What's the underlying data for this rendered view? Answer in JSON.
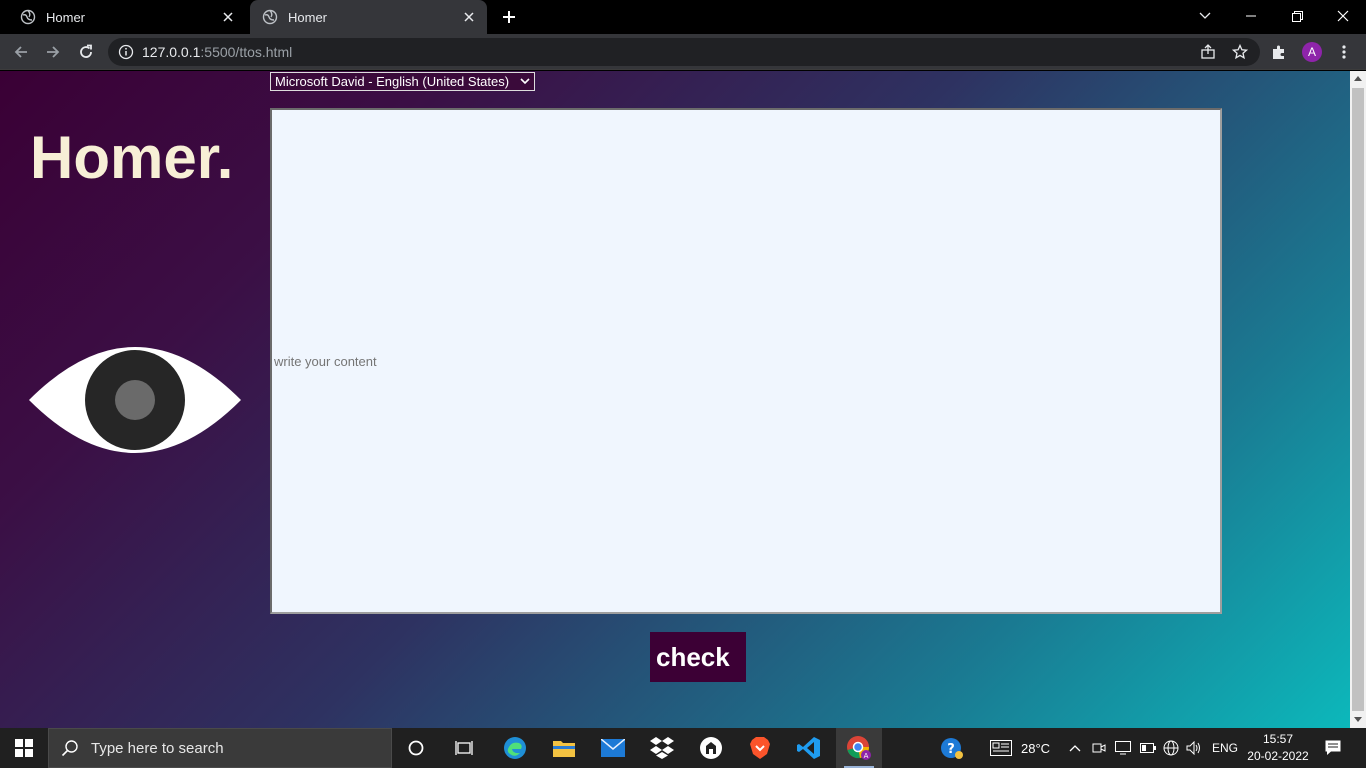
{
  "browser": {
    "tabs": [
      {
        "title": "Homer",
        "active": false
      },
      {
        "title": "Homer",
        "active": true
      }
    ],
    "url_host": "127.0.0.1",
    "url_rest": ":5500/ttos.html",
    "profile_initial": "A"
  },
  "page": {
    "voice_selected": "Microsoft David - English (United States)",
    "brand": "Homer.",
    "textarea_placeholder": "write your content",
    "check_button": "check"
  },
  "taskbar": {
    "search_placeholder": "Type here to search",
    "temperature": "28°C",
    "language": "ENG",
    "time": "15:57",
    "date": "20-02-2022"
  },
  "colors": {
    "page_gradient_start": "#3a0035",
    "page_gradient_end": "#0cb8bb",
    "brand_text": "#f7efd6",
    "button_bg": "#3c0035",
    "textarea_bg": "#f0f6fe"
  }
}
